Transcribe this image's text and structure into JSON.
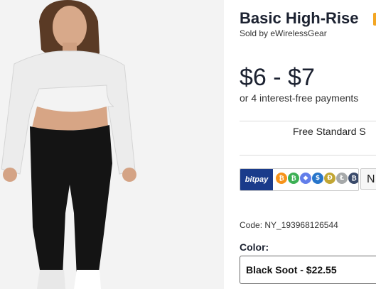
{
  "product": {
    "title": "Basic High-Rise",
    "seller": "Sold by eWirelessGear",
    "price": "$6 - $7",
    "installments": "or 4 interest-free payments",
    "shipping": "Free Standard S",
    "code": "Code: NY_193968126544",
    "color_label": "Color:",
    "color_selected": "Black Soot - $22.55"
  },
  "payment": {
    "bitpay_label": "bitpay",
    "next_label": "N",
    "coins": [
      {
        "name": "bitcoin-icon",
        "glyph": "₿",
        "color": "#f7931a"
      },
      {
        "name": "bitcoin-cash-icon",
        "glyph": "₿",
        "color": "#3cb054"
      },
      {
        "name": "ethereum-icon",
        "glyph": "◆",
        "color": "#627eea"
      },
      {
        "name": "usdc-icon",
        "glyph": "$",
        "color": "#2775ca"
      },
      {
        "name": "dogecoin-icon",
        "glyph": "Ð",
        "color": "#c2a633"
      },
      {
        "name": "litecoin-icon",
        "glyph": "Ł",
        "color": "#a6a9aa"
      },
      {
        "name": "wrapped-btc-icon",
        "glyph": "₿",
        "color": "#3a4a6a"
      },
      {
        "name": "shiba-inu-icon",
        "glyph": "●",
        "color": "#e0521b"
      }
    ]
  },
  "colors": {
    "title_badge": "#f3a623",
    "bitpay_blue": "#1a3b8b"
  }
}
